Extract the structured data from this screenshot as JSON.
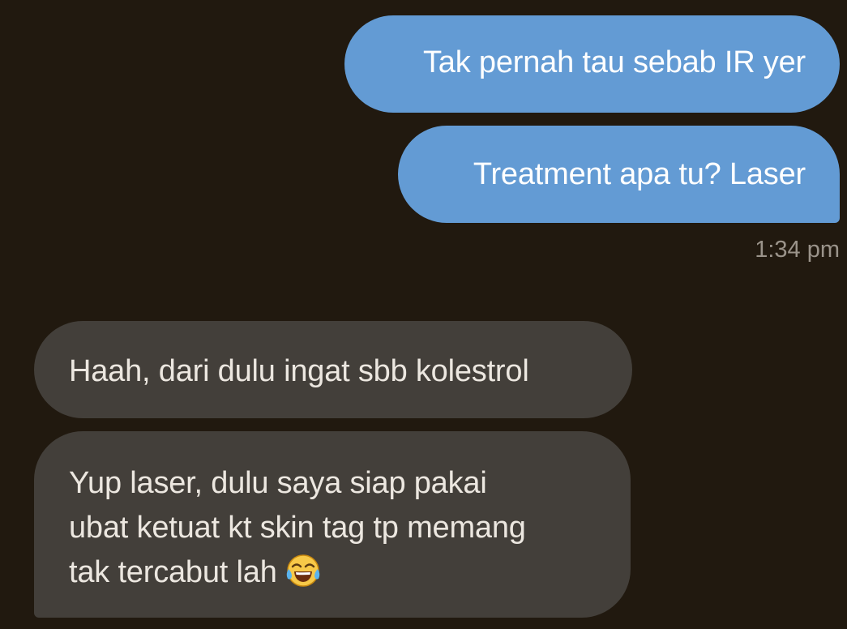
{
  "conversation": {
    "messages": [
      {
        "direction": "outgoing",
        "text": "Tak pernah tau sebab IR yer"
      },
      {
        "direction": "outgoing",
        "text": "Treatment apa tu? Laser"
      },
      {
        "direction": "incoming",
        "text": "Haah, dari dulu ingat sbb kolestrol"
      },
      {
        "direction": "incoming",
        "lines": [
          "Yup laser, dulu saya siap pakai",
          "ubat ketuat kt skin tag tp memang",
          "tak tercabut lah"
        ],
        "emoji": "face-with-tears-of-joy-icon"
      }
    ],
    "outgoing_timestamp": "1:34 pm"
  },
  "colors": {
    "background": "#21190f",
    "outgoing_bubble": "#639bd4",
    "incoming_bubble": "#433f3a",
    "outgoing_text": "#ffffff",
    "incoming_text": "#ece7e0",
    "timestamp_text": "#9a938a"
  }
}
